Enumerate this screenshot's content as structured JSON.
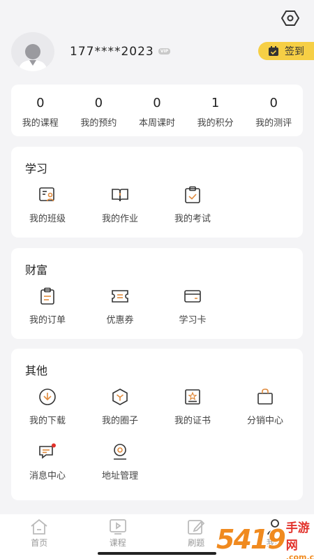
{
  "header": {
    "settings_icon": "hexagon-settings-icon"
  },
  "profile": {
    "phone": "177****2023",
    "vip_badge": "VIP",
    "checkin_label": "签到",
    "checkin_color": "#f6cf45"
  },
  "stats": [
    {
      "value": "0",
      "label": "我的课程"
    },
    {
      "value": "0",
      "label": "我的预约"
    },
    {
      "value": "0",
      "label": "本周课时"
    },
    {
      "value": "1",
      "label": "我的积分"
    },
    {
      "value": "0",
      "label": "我的测评"
    }
  ],
  "study": {
    "title": "学习",
    "items": [
      {
        "label": "我的班级",
        "icon": "class-icon"
      },
      {
        "label": "我的作业",
        "icon": "book-icon"
      },
      {
        "label": "我的考试",
        "icon": "exam-icon"
      }
    ]
  },
  "wealth": {
    "title": "财富",
    "items": [
      {
        "label": "我的订单",
        "icon": "order-icon"
      },
      {
        "label": "优惠券",
        "icon": "coupon-icon"
      },
      {
        "label": "学习卡",
        "icon": "card-icon"
      }
    ]
  },
  "other": {
    "title": "其他",
    "items": [
      {
        "label": "我的下载",
        "icon": "download-icon"
      },
      {
        "label": "我的圈子",
        "icon": "circle-icon"
      },
      {
        "label": "我的证书",
        "icon": "certificate-icon"
      },
      {
        "label": "分销中心",
        "icon": "bag-icon"
      },
      {
        "label": "消息中心",
        "icon": "message-icon"
      },
      {
        "label": "地址管理",
        "icon": "location-icon"
      }
    ]
  },
  "tabbar": [
    {
      "label": "首页",
      "icon": "home-icon"
    },
    {
      "label": "课程",
      "icon": "video-icon"
    },
    {
      "label": "刷题",
      "icon": "edit-icon"
    },
    {
      "label": "我的",
      "icon": "user-icon"
    }
  ],
  "watermark": {
    "number": "5419",
    "cn": "手游网",
    "url": ".com.cn"
  },
  "colors": {
    "accent": "#f6cf45",
    "icon_accent": "#e08a3c",
    "badge_red": "#e2322b"
  }
}
